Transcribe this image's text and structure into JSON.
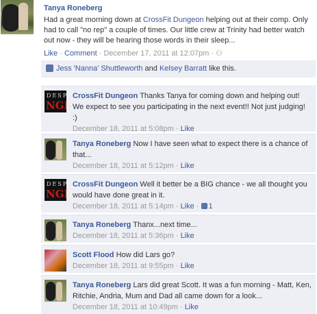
{
  "post": {
    "author": "Tanya Roneberg",
    "text_before": "Had a great morning down at ",
    "text_link": "CrossFit Dungeon",
    "text_after": " helping out at their comp. Only had to call \"no rep\" a couple of times. Our little crew at Trinity had better watch out now - they will be hearing those words in their sleep...",
    "like_label": "Like",
    "comment_label": "Comment",
    "timestamp": "December 17, 2011 at 12:07pm"
  },
  "likes": {
    "person1": "Jess 'Nanna' Shuttleworth",
    "and_text": " and ",
    "person2": "Kelsey Barratt",
    "suffix": " like this."
  },
  "comments": [
    {
      "author": "CrossFit Dungeon",
      "text": "Thanks Tanya for coming down and helping out! We expect to see you participating in the next event!! Not just judging! :)",
      "timestamp": "December 18, 2011 at 5:08pm",
      "like_label": "Like"
    },
    {
      "author": "Tanya Roneberg",
      "text": "Now I have seen what to expect there is a chance of that...",
      "timestamp": "December 18, 2011 at 5:12pm",
      "like_label": "Like"
    },
    {
      "author": "CrossFit Dungeon",
      "text": "Well it better be a BIG chance - we all thought you would have done great in it.",
      "timestamp": "December 18, 2011 at 5:14pm",
      "like_label": "Like",
      "like_count": "1"
    },
    {
      "author": "Tanya Roneberg",
      "text": "Thanx...next time...",
      "timestamp": "December 18, 2011 at 5:36pm",
      "like_label": "Like"
    },
    {
      "author": "Scott Flood",
      "text": "How did Lars go?",
      "timestamp": "December 18, 2011 at 9:55pm",
      "like_label": "Like"
    },
    {
      "author": "Tanya Roneberg",
      "text": "Lars did great Scott. It was a fun morning - Matt, Ken, Ritchie, Andria, Mum and Dad all came down for a look...",
      "timestamp": "December 18, 2011 at 10:49pm",
      "like_label": "Like"
    }
  ],
  "avatar": {
    "cf_top": "DESP",
    "cf_bottom": "NGE"
  },
  "meta_separator": " · "
}
